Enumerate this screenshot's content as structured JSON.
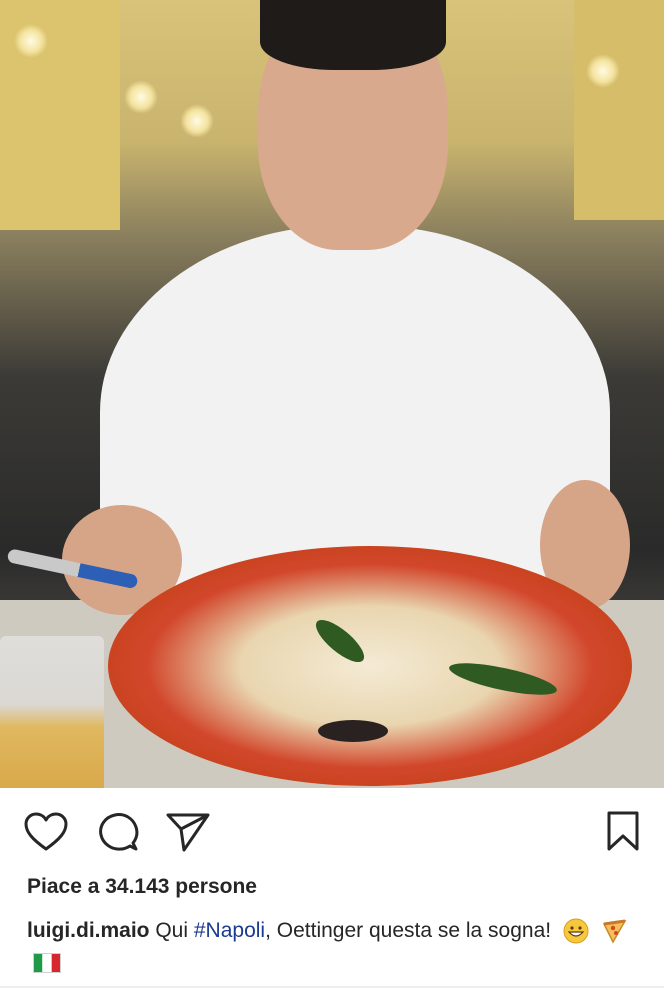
{
  "post": {
    "likes_text": "Piace a 34.143 persone",
    "username": "luigi.di.maio",
    "caption_before": " Qui ",
    "hashtag": "#Napoli",
    "caption_after": ", Oettinger questa se la sogna!",
    "emojis": [
      "grinning-face-emoji",
      "pizza-emoji",
      "italy-flag-emoji"
    ]
  },
  "icons": {
    "like": "heart-icon",
    "comment": "comment-bubble-icon",
    "share": "paper-plane-icon",
    "save": "bookmark-icon"
  }
}
